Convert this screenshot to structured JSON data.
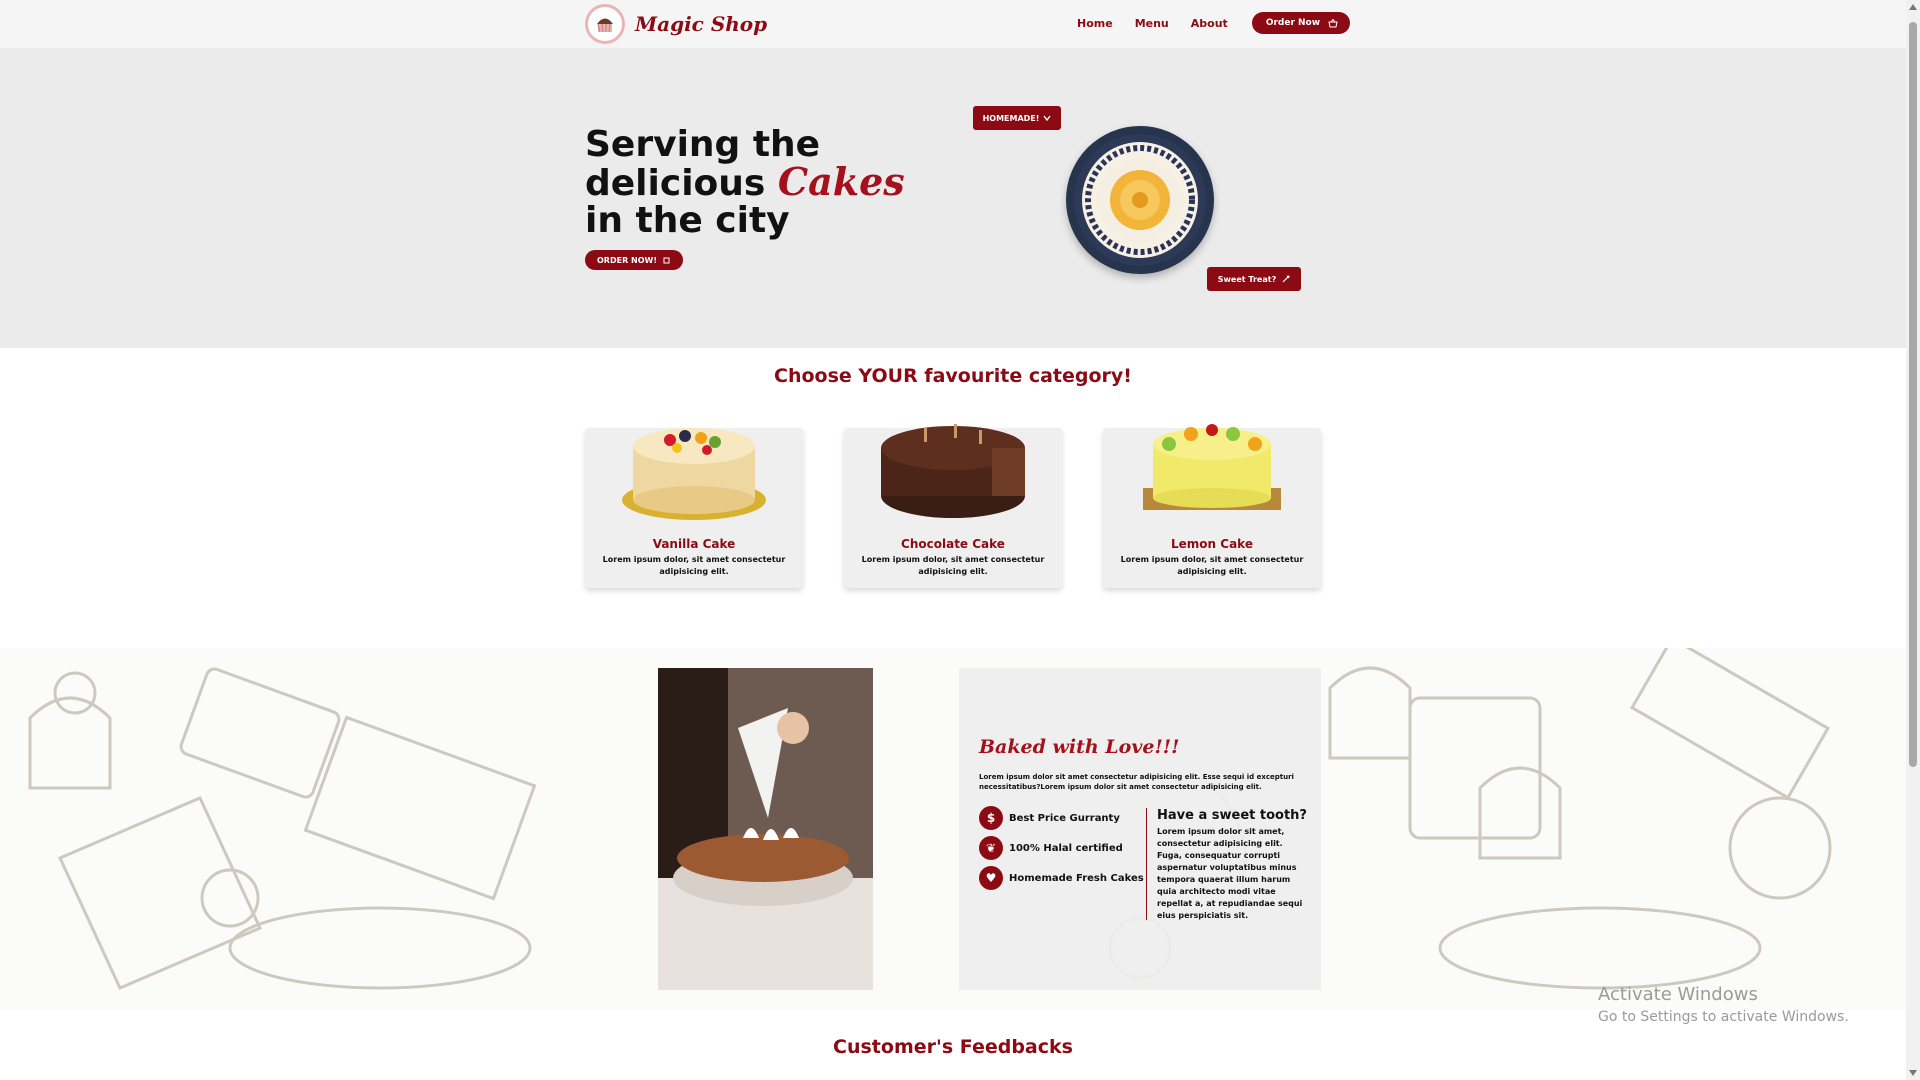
{
  "brand": {
    "name": "Magic Shop",
    "logo_text": "Magic Shop"
  },
  "nav": {
    "items": [
      {
        "label": "Home"
      },
      {
        "label": "Menu"
      },
      {
        "label": "About"
      }
    ],
    "order_button": "Order Now"
  },
  "hero": {
    "title_before": "Serving the delicious ",
    "title_accent": "Cakes",
    "title_after": " in the city",
    "order_button": "ORDER NOW!",
    "tag_homemade": "HOMEMADE!",
    "tag_sweet": "Sweet Treat?"
  },
  "category": {
    "title": "Choose YOUR favourite category!",
    "cards": [
      {
        "title": "Vanilla Cake",
        "desc": "Lorem ipsum dolor, sit amet consectetur adipisicing elit."
      },
      {
        "title": "Chocolate Cake",
        "desc": "Lorem ipsum dolor, sit amet consectetur adipisicing elit."
      },
      {
        "title": "Lemon Cake",
        "desc": "Lorem ipsum dolor, sit amet consectetur adipisicing elit."
      }
    ]
  },
  "about": {
    "heading": "Baked with Love!!!",
    "text": "Lorem ipsum dolor sit amet consectetur adipisicing elit. Esse sequi id excepturi necessitatibus?Lorem ipsum dolor sit amet consectetur adipisicing elit.",
    "features": [
      {
        "icon": "dollar-icon",
        "glyph": "$",
        "label": "Best Price Gurranty"
      },
      {
        "icon": "leaf-icon",
        "glyph": "❦",
        "label": "100% Halal certified"
      },
      {
        "icon": "hand-heart-icon",
        "glyph": "♥",
        "label": "Homemade Fresh Cakes"
      }
    ],
    "sweet_heading": "Have a sweet tooth?",
    "sweet_text": "Lorem ipsum dolor sit amet, consectetur adipisicing elit. Fuga, consequatur corrupti aspernatur voluptatibus minus tempora quaerat illum harum quia architecto modi vitae repellat a, at repudiandae sequi eius perspiciatis sit."
  },
  "feedback": {
    "title": "Customer's Feedbacks"
  },
  "windows": {
    "activate_title": "Activate Windows",
    "activate_sub": "Go to Settings to activate Windows."
  },
  "colors": {
    "accent": "#8b0a14",
    "hero_bg": "#ebebeb",
    "header_bg": "#f5f5f5"
  }
}
